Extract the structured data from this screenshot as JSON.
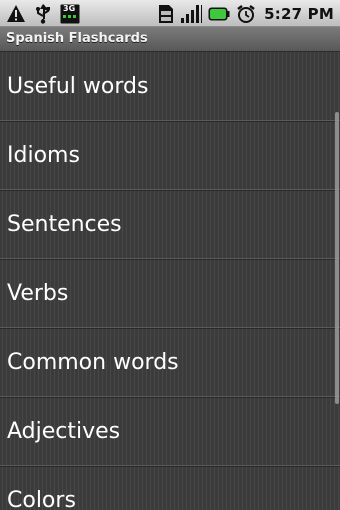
{
  "status_bar": {
    "icons": [
      "warning-icon",
      "usb-icon",
      "3g-icon",
      "sd-card-icon",
      "signal-icon",
      "battery-icon",
      "alarm-icon"
    ],
    "network_label": "3G",
    "time": "5:27 PM",
    "battery_color": "#3ec83e"
  },
  "app": {
    "title": "Spanish Flashcards"
  },
  "list": {
    "items": [
      {
        "label": "Useful words"
      },
      {
        "label": "Idioms"
      },
      {
        "label": "Sentences"
      },
      {
        "label": "Verbs"
      },
      {
        "label": "Common words"
      },
      {
        "label": "Adjectives"
      },
      {
        "label": "Colors"
      }
    ]
  }
}
